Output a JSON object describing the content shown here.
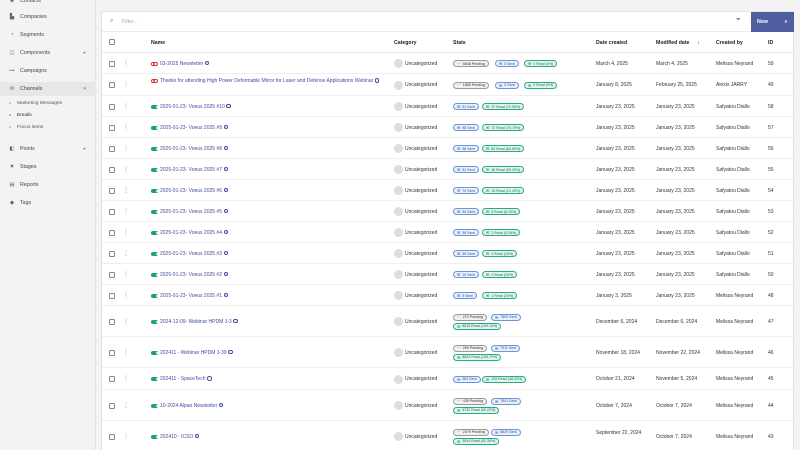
{
  "sidebar": {
    "items": [
      {
        "label": "Contacts",
        "icon": "contacts-icon",
        "glyph": "☻"
      },
      {
        "label": "Companies",
        "icon": "companies-icon",
        "glyph": "▙"
      },
      {
        "label": "Segments",
        "icon": "segments-icon",
        "glyph": "◔"
      },
      {
        "label": "Components",
        "icon": "components-icon",
        "glyph": "◫"
      },
      {
        "label": "Campaigns",
        "icon": "campaigns-icon",
        "glyph": "⊶"
      },
      {
        "label": "Channels",
        "icon": "channels-icon",
        "glyph": "✉"
      },
      {
        "label": "Points",
        "icon": "points-icon",
        "glyph": "◧"
      },
      {
        "label": "Stages",
        "icon": "stages-icon",
        "glyph": "▼"
      },
      {
        "label": "Reports",
        "icon": "reports-icon",
        "glyph": "▤"
      },
      {
        "label": "Tags",
        "icon": "tags-icon",
        "glyph": "◆"
      }
    ],
    "chevron": "▸",
    "chevron_open": "▾",
    "channels_sub": [
      "Marketing Messages",
      "Emails",
      "Focus items"
    ]
  },
  "toolbar": {
    "search_icon": "⌕",
    "filter_placeholder": "Filter...",
    "funnel_icon": "⏷",
    "new_label": "New",
    "new_caret": "▾"
  },
  "table": {
    "headers": {
      "name": "Name",
      "category": "Category",
      "stats": "Stats",
      "date_created": "Date created",
      "date_modified": "Modified date",
      "sort_arrow": "↓",
      "created_by": "Created by",
      "id": "ID"
    },
    "rows": [
      {
        "published": false,
        "name": "03-2025 Newsletter",
        "category": "Uncategorized",
        "stats": [
          {
            "type": "pending",
            "text": "8848 Pending"
          },
          {
            "type": "sent",
            "text": "0 Sent"
          },
          {
            "type": "read",
            "text": "0 Read (0%)"
          }
        ],
        "created": "March 4, 2025",
        "modified": "March 4, 2025",
        "by": "Melissa Neyrand",
        "id": "59"
      },
      {
        "published": false,
        "name": "Thanks for attending High Power Deformable Mirror for Laser and Defense Applications Webinar",
        "category": "Uncategorized",
        "stats": [
          {
            "type": "pending",
            "text": "1865 Pending"
          },
          {
            "type": "sent",
            "text": "0 Sent"
          },
          {
            "type": "read",
            "text": "0 Read (0%)"
          }
        ],
        "created": "January 8, 2025",
        "modified": "February 25, 2025",
        "by": "Alexis JARRY",
        "id": "49"
      },
      {
        "published": true,
        "name": "2025-01-23- Voeux 2025 #10",
        "category": "Uncategorized",
        "stats": [
          {
            "type": "sent",
            "text": "51 Sent"
          },
          {
            "type": "read",
            "text": "37 Read (72.55%)"
          }
        ],
        "created": "January 23, 2025",
        "modified": "January 23, 2025",
        "by": "Safyatou Diallo",
        "id": "58"
      },
      {
        "published": true,
        "name": "2025-01-23- Voeux 2025 #9",
        "category": "Uncategorized",
        "stats": [
          {
            "type": "sent",
            "text": "95 Sent"
          },
          {
            "type": "read",
            "text": "72 Read (75.79%)"
          }
        ],
        "created": "January 23, 2025",
        "modified": "January 23, 2025",
        "by": "Safyatou Diallo",
        "id": "57"
      },
      {
        "published": true,
        "name": "2025-01-23- Voeux 2025 #8",
        "category": "Uncategorized",
        "stats": [
          {
            "type": "sent",
            "text": "98 Sent"
          },
          {
            "type": "read",
            "text": "83 Read (84.69%)"
          }
        ],
        "created": "January 23, 2025",
        "modified": "January 23, 2025",
        "by": "Safyatou Diallo",
        "id": "56"
      },
      {
        "published": true,
        "name": "2025-01-23- Voeux 2025 #7",
        "category": "Uncategorized",
        "stats": [
          {
            "type": "sent",
            "text": "51 Sent"
          },
          {
            "type": "read",
            "text": "46 Read (90.20%)"
          }
        ],
        "created": "January 23, 2025",
        "modified": "January 23, 2025",
        "by": "Safyatou Diallo",
        "id": "55"
      },
      {
        "published": true,
        "name": "2025-01-23- Voeux 2025 #6",
        "category": "Uncategorized",
        "stats": [
          {
            "type": "sent",
            "text": "70 Sent"
          },
          {
            "type": "read",
            "text": "15 Read (21.43%)"
          }
        ],
        "created": "January 23, 2025",
        "modified": "January 23, 2025",
        "by": "Safyatou Diallo",
        "id": "54"
      },
      {
        "published": true,
        "name": "2025-01-23- Voeux 2025 #5",
        "category": "Uncategorized",
        "stats": [
          {
            "type": "sent",
            "text": "60 Sent"
          },
          {
            "type": "read",
            "text": "5 Read (8.33%)"
          }
        ],
        "created": "January 23, 2025",
        "modified": "January 23, 2025",
        "by": "Safyatou Diallo",
        "id": "53"
      },
      {
        "published": true,
        "name": "2025-01-23- Voeux 2025 #4",
        "category": "Uncategorized",
        "stats": [
          {
            "type": "sent",
            "text": "38 Sent"
          },
          {
            "type": "read",
            "text": "2 Read (5.26%)"
          }
        ],
        "created": "January 23, 2025",
        "modified": "January 23, 2025",
        "by": "Safyatou Diallo",
        "id": "52"
      },
      {
        "published": true,
        "name": "2025-01-23- Voeux 2025 #3",
        "category": "Uncategorized",
        "stats": [
          {
            "type": "sent",
            "text": "25 Sent"
          },
          {
            "type": "read",
            "text": "4 Read (16%)"
          }
        ],
        "created": "January 23, 2025",
        "modified": "January 23, 2025",
        "by": "Safyatou Diallo",
        "id": "51"
      },
      {
        "published": true,
        "name": "2025-01-23- Voeux 2025 #2",
        "category": "Uncategorized",
        "stats": [
          {
            "type": "sent",
            "text": "10 Sent"
          },
          {
            "type": "read",
            "text": "2 Read (20%)"
          }
        ],
        "created": "January 23, 2025",
        "modified": "January 23, 2025",
        "by": "Safyatou Diallo",
        "id": "50"
      },
      {
        "published": true,
        "name": "2025-01-23- Voeux 2025 #1",
        "category": "Uncategorized",
        "stats": [
          {
            "type": "sent",
            "text": "5 Sent"
          },
          {
            "type": "read",
            "text": "1 Read (20%)"
          }
        ],
        "created": "January 3, 2025",
        "modified": "January 23, 2025",
        "by": "Melissa Neyrand",
        "id": "48"
      },
      {
        "published": true,
        "name": "2024-12-09- Webinar HPDM J-3",
        "category": "Uncategorized",
        "stats": [
          {
            "type": "pending",
            "text": "270 Pending"
          },
          {
            "type": "sent",
            "text": "7809 Sent"
          },
          {
            "type": "read",
            "text": "8518 Read (109.14%)"
          }
        ],
        "created": "December 6, 2024",
        "modified": "December 6, 2024",
        "by": "Melissa Neyrand",
        "id": "47"
      },
      {
        "published": true,
        "name": "202411 - Webinar HPDM J-30",
        "category": "Uncategorized",
        "stats": [
          {
            "type": "pending",
            "text": "259 Pending"
          },
          {
            "type": "sent",
            "text": "7911 Sent"
          },
          {
            "type": "read",
            "text": "8604 Read (108.79%)"
          }
        ],
        "created": "November 18, 2024",
        "modified": "November 22, 2024",
        "by": "Melissa Neyrand",
        "id": "46"
      },
      {
        "published": true,
        "name": "202411 - SpaceTech",
        "category": "Uncategorized",
        "stats": [
          {
            "type": "sent",
            "text": "263 Sent"
          },
          {
            "type": "read",
            "text": "128 Read (48.33%)"
          }
        ],
        "created": "October 21, 2024",
        "modified": "November 5, 2024",
        "by": "Melissa Neyrand",
        "id": "45"
      },
      {
        "published": true,
        "name": "10-2024 Alpao Newsletter",
        "category": "Uncategorized",
        "stats": [
          {
            "type": "pending",
            "text": "435 Pending"
          },
          {
            "type": "sent",
            "text": "7941 Sent"
          },
          {
            "type": "read",
            "text": "4732 Read (60.22%)"
          }
        ],
        "created": "October 7, 2024",
        "modified": "October 7, 2024",
        "by": "Melissa Neyrand",
        "id": "44"
      },
      {
        "published": true,
        "name": "202410 - ICSO",
        "category": "Uncategorized",
        "stats": [
          {
            "type": "pending",
            "text": "2479 Pending"
          },
          {
            "type": "sent",
            "text": "5829 Sent"
          },
          {
            "type": "read",
            "text": "3054 Read (52.39%)"
          }
        ],
        "created": "September 22, 2024",
        "modified": "October 7, 2024",
        "by": "Melissa Neyrand",
        "id": "43"
      }
    ]
  },
  "icons": {
    "kebab": "⋮",
    "mail": "✉",
    "envelope_open": "✉"
  },
  "colors": {
    "link": "#3d4d9e",
    "published": "#17a086",
    "unpublished": "#dd3333",
    "new_button": "#4e5e9e"
  }
}
